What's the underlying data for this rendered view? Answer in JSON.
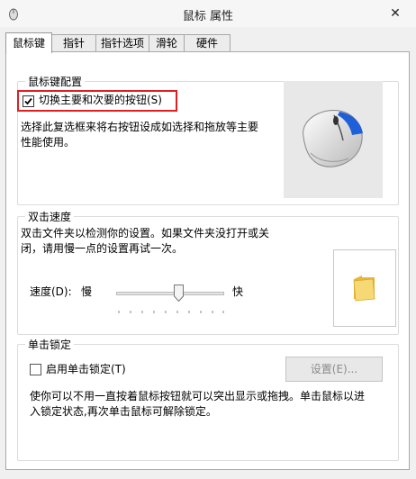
{
  "window": {
    "title": "鼠标 属性",
    "close_label": "✕"
  },
  "tabs": [
    {
      "label": "鼠标键",
      "active": true
    },
    {
      "label": "指针",
      "active": false
    },
    {
      "label": "指针选项",
      "active": false
    },
    {
      "label": "滑轮",
      "active": false
    },
    {
      "label": "硬件",
      "active": false
    }
  ],
  "button_config": {
    "group_label": "鼠标键配置",
    "switch_checkbox": {
      "label": "切换主要和次要的按钮(S)",
      "checked": true
    },
    "description": [
      "选择此复选框来将右按钮设成如选择和拖放等主要",
      "性能使用。"
    ]
  },
  "double_click": {
    "group_label": "双击速度",
    "description": [
      "双击文件夹以检测你的设置。如果文件夹没打开或关",
      "闭，请用慢一点的设置再试一次。"
    ],
    "speed_label": "速度(D):",
    "slow_label": "慢",
    "fast_label": "快",
    "speed_fraction": 0.55
  },
  "click_lock": {
    "group_label": "单击锁定",
    "checkbox": {
      "label": "启用单击锁定(T)",
      "checked": false
    },
    "settings_button": "设置(E)...",
    "description": [
      "使你可以不用一直按着鼠标按钮就可以突出显示或拖拽。单击鼠标以进",
      "入锁定状态,再次单击鼠标可解除锁定。"
    ]
  },
  "colors": {
    "highlight_box": "#e02020",
    "folder": "#f2c94c",
    "mouse_accent": "#1f5fd8"
  }
}
